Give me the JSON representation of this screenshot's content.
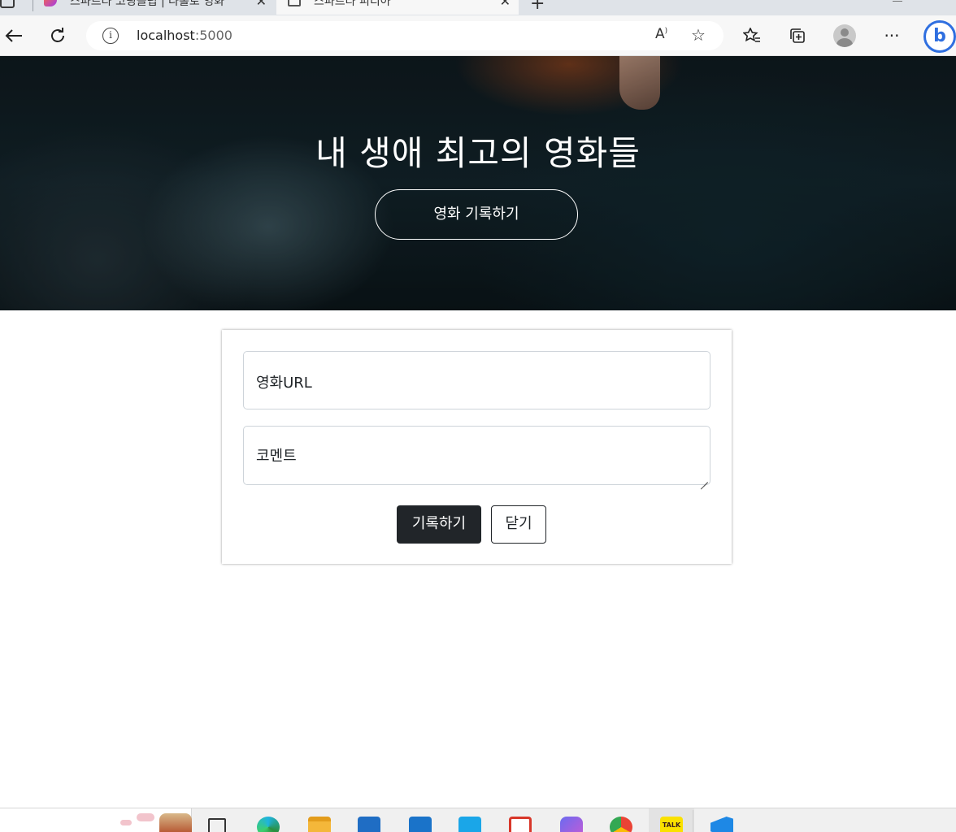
{
  "browser": {
    "tabs": [
      {
        "title": "스파르타 코딩클럽 | 나홀로 영화",
        "active": false
      },
      {
        "title": "스파르타 피디아",
        "active": true
      }
    ],
    "address": {
      "host": "localhost",
      "port": ":5000"
    }
  },
  "hero": {
    "title": "내 생애 최고의 영화들",
    "button_label": "영화 기록하기"
  },
  "form": {
    "url_placeholder": "영화URL",
    "comment_placeholder": "코멘트",
    "save_label": "기록하기",
    "close_label": "닫기"
  },
  "taskbar": {
    "kakao_label": "TALK"
  },
  "colors": {
    "dark_button": "#212529",
    "border": "#ced4da"
  }
}
